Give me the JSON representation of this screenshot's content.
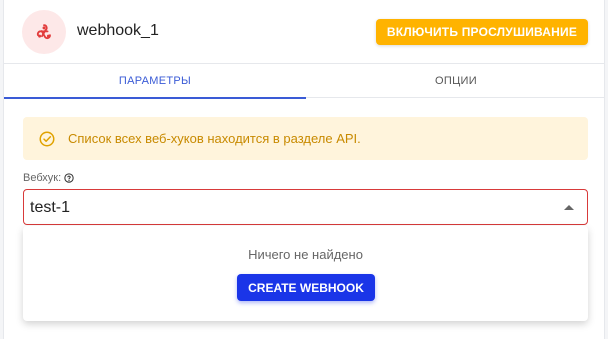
{
  "header": {
    "title": "webhook_1",
    "primary_action_label": "ВКЛЮЧИТЬ ПРОСЛУШИВАНИЕ",
    "avatar_icon": "webhook-icon",
    "accent_color": "#ffb300"
  },
  "tabs": [
    {
      "label": "ПАРАМЕТРЫ",
      "active": true
    },
    {
      "label": "ОПЦИИ",
      "active": false
    }
  ],
  "alert": {
    "icon": "check-circle-icon",
    "text": "Список всех веб-хуков находится в разделе API.",
    "color": "#c88a00"
  },
  "webhook_field": {
    "label": "Вебхук:",
    "help_icon": "question-circle-icon",
    "value": "test-1",
    "error_border_color": "#d83a3a"
  },
  "dropdown": {
    "empty_text": "Ничего не найдено",
    "create_button_label": "CREATE WEBHOOK",
    "create_button_color": "#1a35e8"
  }
}
